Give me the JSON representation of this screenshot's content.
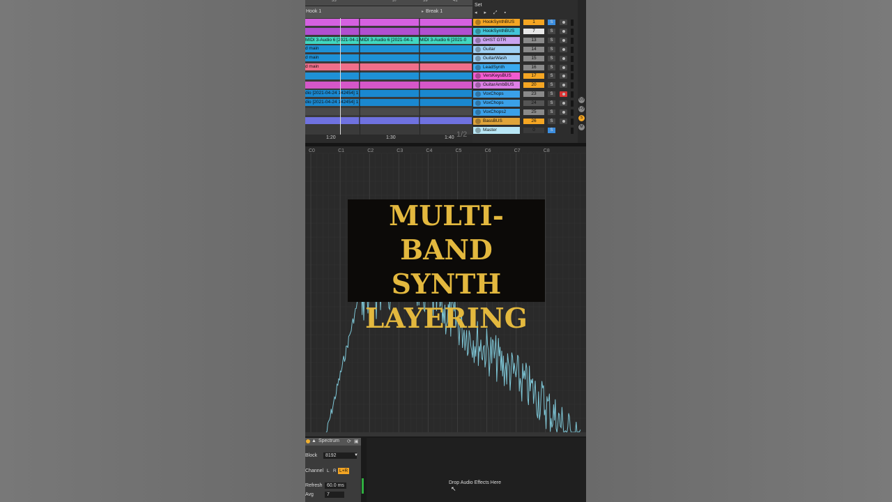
{
  "arrangement": {
    "ruler_marks": [
      "33",
      "37",
      "39",
      "41"
    ],
    "locators": [
      "Hook 1",
      "Break 1"
    ],
    "time_marks": [
      "1:20",
      "1:30",
      "1:40"
    ],
    "page_indicator": "1/2",
    "clip_rows": [
      {
        "text": "",
        "color": "#d561e0"
      },
      {
        "text": "",
        "color": "#b14fd0"
      },
      {
        "text": "MIDI 3-Audio 6 [2021-04-1",
        "text2": "MIDI 3-Audio 6 [2021-04-1",
        "text3": "MIDI 3-Audio 6 [2021-0",
        "color": "#41d7c0"
      },
      {
        "text": "d main",
        "color": "#1e91d6"
      },
      {
        "text": "d main",
        "color": "#1e91d6"
      },
      {
        "text": "d main",
        "color": "#ef6f8a"
      },
      {
        "text": "",
        "color": "#1e91d6"
      },
      {
        "text": "",
        "color": "#d557c9"
      },
      {
        "text": "dio [2021-04-24 142454] 1",
        "color": "#1a88d0"
      },
      {
        "text": "dio [2021-04-24 142454] 1",
        "color": "#1a88d0"
      },
      {
        "text": "",
        "color": "#4a4a4a"
      },
      {
        "text": "",
        "color": "#6f72e0"
      }
    ]
  },
  "mixer": {
    "set_label": "Set",
    "tracks": [
      {
        "name": "HookSynthBUS",
        "num": "1",
        "color": "#f5a623",
        "num_color": "#f5a623",
        "solo_color": "#3c8ee0"
      },
      {
        "name": "HookSynthBUS",
        "num": "7",
        "color": "#41c4d8",
        "num_color": "#e8e8e8",
        "solo_color": "#444"
      },
      {
        "name": "GHST GTR",
        "num": "13",
        "color": "#c9a3f0",
        "num_color": "#8a8a8a",
        "solo_color": "#444"
      },
      {
        "name": "Guitar",
        "num": "14",
        "color": "#9fd0f5",
        "num_color": "#8a8a8a",
        "solo_color": "#444"
      },
      {
        "name": "GuitarWash",
        "num": "15",
        "color": "#9fd0f5",
        "num_color": "#8a8a8a",
        "solo_color": "#444"
      },
      {
        "name": "LeadSynth",
        "num": "16",
        "color": "#39a9f0",
        "num_color": "#8a8a8a",
        "solo_color": "#444"
      },
      {
        "name": "VersKeysBUS",
        "num": "17",
        "color": "#f25bd0",
        "num_color": "#f5a623",
        "solo_color": "#444"
      },
      {
        "name": "GuitarAmbBUS",
        "num": "20",
        "color": "#dd7fe6",
        "num_color": "#f5a623",
        "solo_color": "#444"
      },
      {
        "name": "VoxChops",
        "num": "23",
        "color": "#3aa0e8",
        "num_color": "#8a8a8a",
        "solo_color": "#444"
      },
      {
        "name": "VoxChops",
        "num": "24",
        "color": "#3aa0e8",
        "num_color": "#555",
        "solo_color": "#444"
      },
      {
        "name": "VoxChops2",
        "num": "25",
        "color": "#3aa0e8",
        "num_color": "#8a8a8a",
        "solo_color": "#444"
      },
      {
        "name": "BassBUS",
        "num": "26",
        "color": "#e0a43a",
        "num_color": "#f5a623",
        "solo_color": "#444"
      },
      {
        "name": "Master",
        "num": "0",
        "color": "#b8e6f5",
        "num_color": "#3a3a3a",
        "solo_color": "#3c8ee0"
      }
    ],
    "solo_label": "S",
    "side_labels": [
      "CO",
      "I-O",
      "S",
      "M"
    ]
  },
  "spectrum": {
    "note_labels": [
      "C0",
      "C1",
      "C2",
      "C3",
      "C4",
      "C5",
      "C6",
      "C7",
      "C8"
    ],
    "line_color": "#7ec6d6"
  },
  "overlay": {
    "lines": [
      "MULTI-BAND",
      "SYNTH",
      "LAYERING"
    ],
    "text_color": "#e3b83e"
  },
  "device": {
    "title": "Spectrum",
    "block_label": "Block",
    "block_value": "8192",
    "channel_label": "Channel",
    "channel_options": [
      "L",
      "R",
      "L+R"
    ],
    "refresh_label": "Refresh",
    "refresh_value": "60.0 ms",
    "avg_label": "Avg",
    "avg_value": "7",
    "drop_text": "Drop Audio Effects Here"
  }
}
